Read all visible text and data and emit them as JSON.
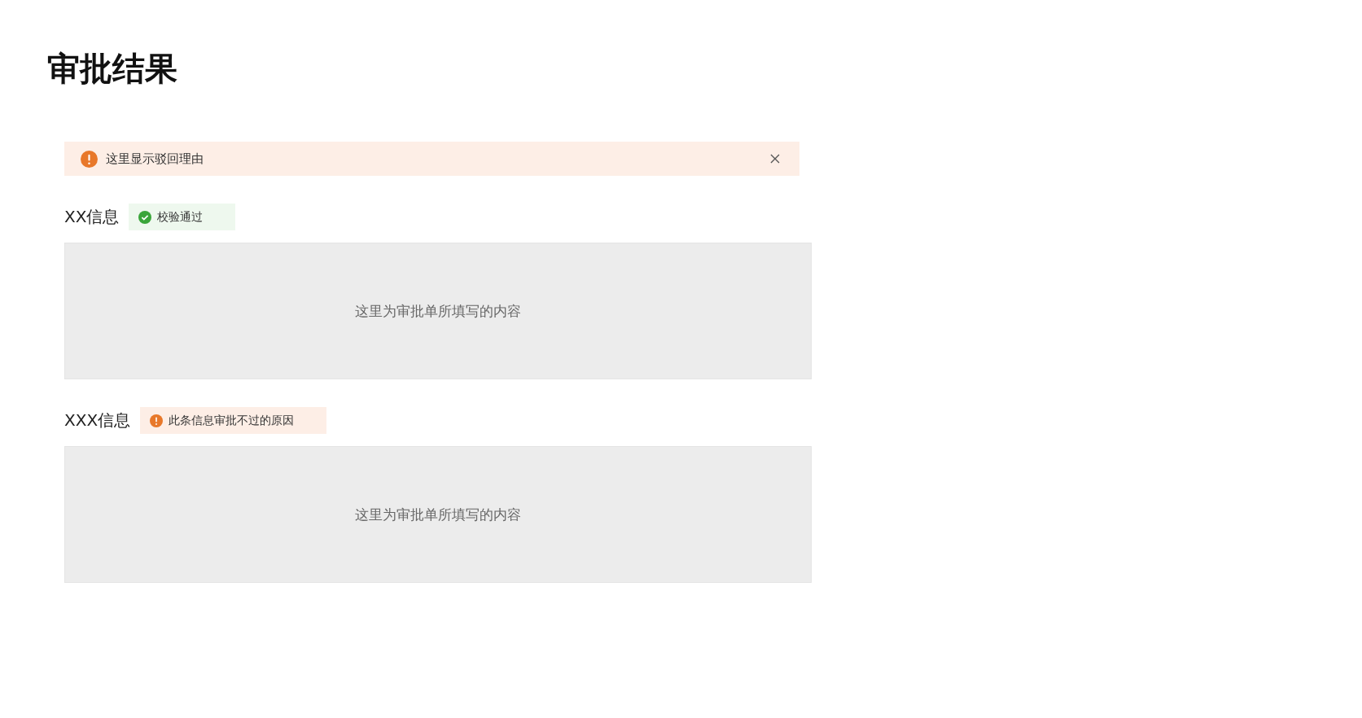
{
  "title": "审批结果",
  "alert": {
    "kind": "warning",
    "message": "这里显示驳回理由"
  },
  "sections": [
    {
      "heading": "XX信息",
      "status": {
        "kind": "success",
        "text": "校验通过"
      },
      "content": "这里为审批单所填写的内容"
    },
    {
      "heading": "XXX信息",
      "status": {
        "kind": "warning",
        "text": "此条信息审批不过的原因"
      },
      "content": "这里为审批单所填写的内容"
    }
  ]
}
